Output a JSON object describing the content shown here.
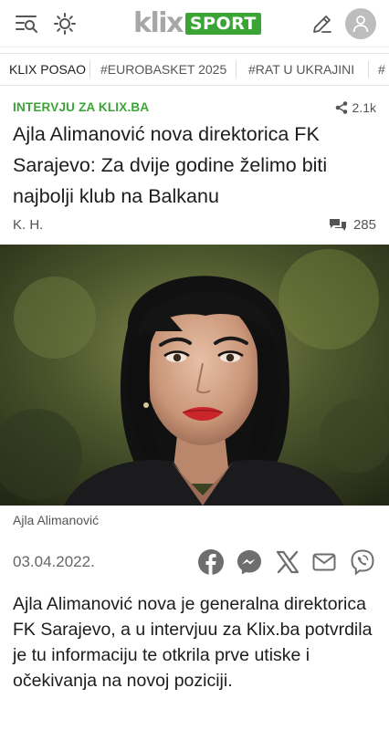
{
  "header": {
    "logo_main": "klix",
    "logo_sub": "SPORT",
    "icons": [
      "menu-search-icon",
      "sun-icon",
      "edit-icon",
      "user-icon"
    ]
  },
  "tags": [
    "KLIX POSAO",
    "#EUROBASKET 2025",
    "#RAT U UKRAJINI",
    "#"
  ],
  "article": {
    "kicker": "INTERVJU ZA KLIX.BA",
    "shares": "2.1k",
    "title": "Ajla Alimanović nova direktorica FK Sarajevo: Za dvije godine želimo biti najbolji klub na Balkanu",
    "author": "K. H.",
    "comments": "285",
    "caption": "Ajla Alimanović",
    "date": "03.04.2022.",
    "share_icons": [
      "facebook-icon",
      "messenger-icon",
      "x-icon",
      "email-icon",
      "viber-icon"
    ],
    "lead": "Ajla Alimanović nova je generalna direktorica FK Sarajevo, a u intervjuu za Klix.ba potvrdila je tu informaciju te otkrila prve utiske i očekivanja na novoj poziciji."
  },
  "colors": {
    "accent_green": "#3aa535",
    "logo_gray": "#a7a7a7",
    "icon_gray": "#6e6e6e"
  }
}
